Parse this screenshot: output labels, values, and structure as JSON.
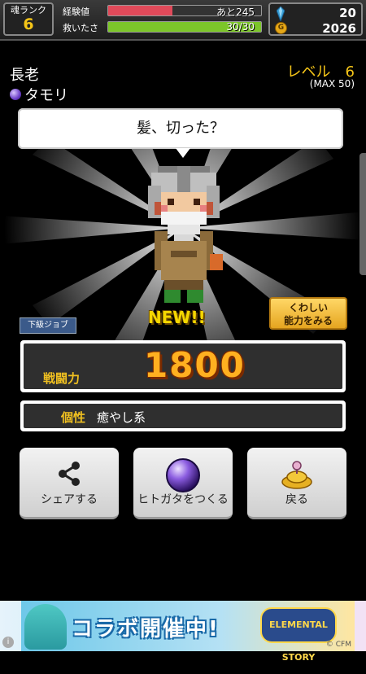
{
  "header": {
    "soul_rank_label": "魂ランク",
    "soul_rank_value": "6",
    "exp_label": "経験値",
    "exp_text": "あと245",
    "exp_fraction": 0.42,
    "rescue_label": "救いたさ",
    "rescue_text": "30/30",
    "rescue_fraction": 1.0,
    "gems": "20",
    "gold": "2026",
    "gold_icon": "G"
  },
  "character": {
    "title": "長老",
    "name": "タモリ",
    "level": "レベル　6",
    "max_level": "(MAX 50)",
    "speech": "髪、切った？",
    "new_label": "NEW!!",
    "job_badge": "下級ジョブ",
    "details_button": [
      "くわしい",
      "能力をみる"
    ]
  },
  "stats": {
    "power_label": "戦闘力",
    "power_value": "1800",
    "trait_label": "個性",
    "trait_value": "癒やし系"
  },
  "actions": {
    "share": "シェアする",
    "create": "ヒトガタをつくる",
    "back": "戻る"
  },
  "banner": {
    "text": "コラボ開催中!",
    "logo": "ELEMENTAL STORY",
    "copyright": "© CFM",
    "info": "i"
  },
  "colors": {
    "exp_bar": "#e04a5a",
    "rescue_bar": "#7cc62a",
    "accent_gold": "#f5c518"
  }
}
